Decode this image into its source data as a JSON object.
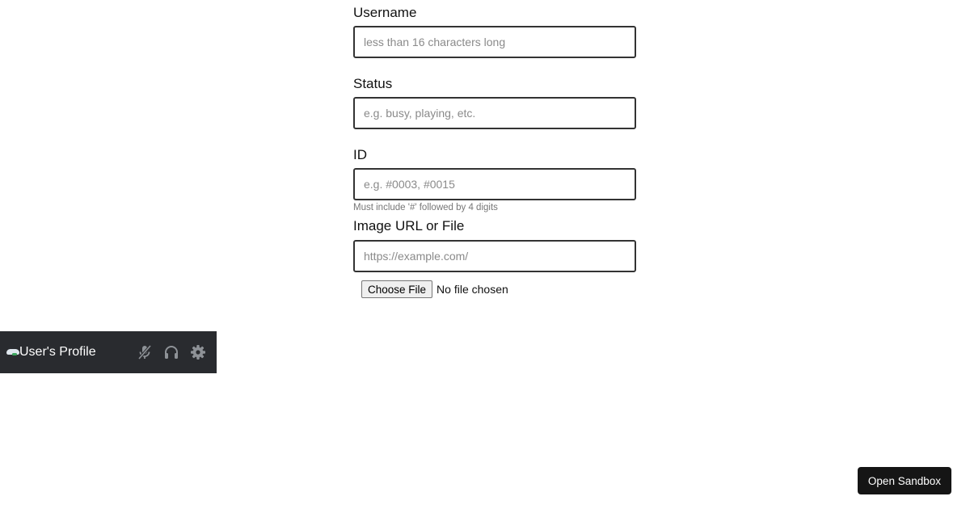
{
  "form": {
    "fields": [
      {
        "label": "Username",
        "value": "",
        "placeholder": "less than 16 characters long"
      },
      {
        "label": "Status",
        "value": "",
        "placeholder": "e.g. busy, playing, etc."
      },
      {
        "label": "ID",
        "value": "",
        "placeholder": "e.g. #0003, #0015",
        "hint": "Must include '#' followed by 4 digits"
      },
      {
        "label": "Image URL or File",
        "value": "",
        "placeholder": "https://example.com/"
      }
    ],
    "file_input": {
      "button_label": "Choose File",
      "status": "No file chosen"
    }
  },
  "user_bar": {
    "name": "User's Profile",
    "status_color": "#3ba55d",
    "icons": [
      "mute-microphone-icon",
      "headphones-icon",
      "settings-gear-icon"
    ]
  },
  "sandbox_button": {
    "label": "Open Sandbox"
  }
}
